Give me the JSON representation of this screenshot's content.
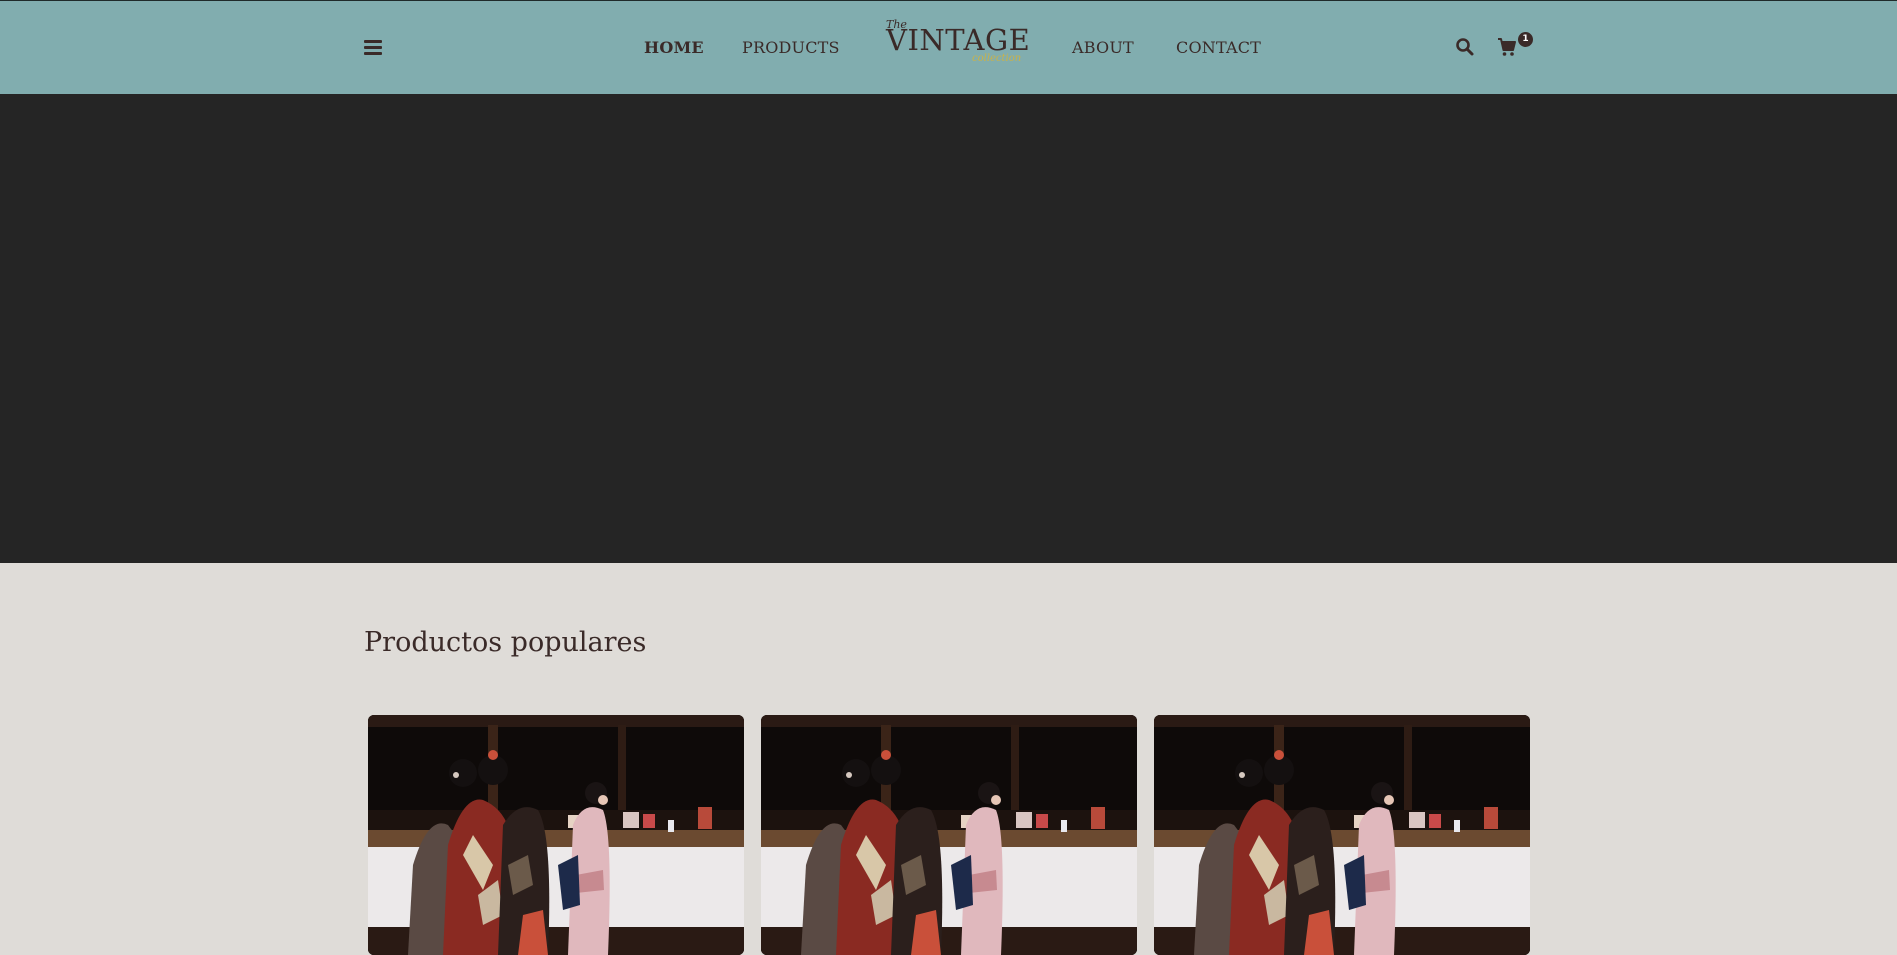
{
  "nav": {
    "menu_icon": "hamburger-menu-icon",
    "links": [
      {
        "label": "HOME",
        "active": true
      },
      {
        "label": "PRODUCTS",
        "active": false
      },
      {
        "label": "ABOUT",
        "active": false
      },
      {
        "label": "CONTACT",
        "active": false
      }
    ],
    "logo": {
      "the": "The",
      "main": "VINTAGE",
      "sub": "collection"
    },
    "search_icon": "search-icon",
    "cart_icon": "shopping-cart-icon",
    "cart_count": "1"
  },
  "colors": {
    "navbar": "#81adaf",
    "hero": "#252525",
    "page_background": "#dfdcd8",
    "text": "#3a2a28",
    "logo_accent": "#c9b24a"
  },
  "popular": {
    "title": "Productos populares",
    "products": [
      {
        "image": "kimono-women-at-shrine-photo"
      },
      {
        "image": "kimono-women-at-shrine-photo"
      },
      {
        "image": "kimono-women-at-shrine-photo"
      }
    ]
  }
}
